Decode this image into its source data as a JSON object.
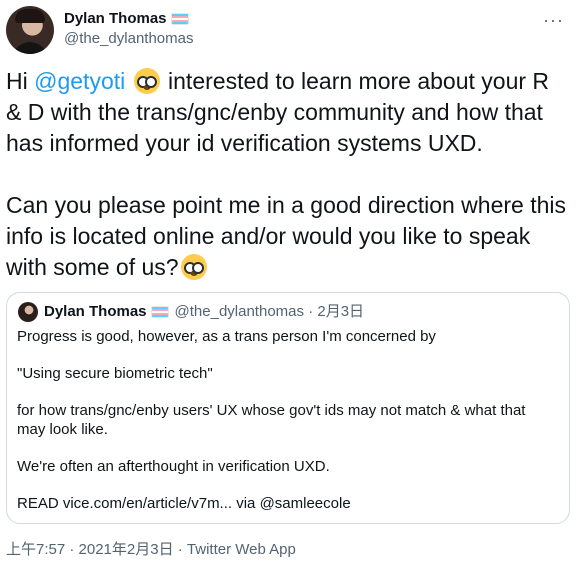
{
  "author": {
    "display_name": "Dylan Thomas",
    "handle": "@the_dylanthomas",
    "flag": "transgender-flag-icon"
  },
  "tweet": {
    "p1_a": "Hi ",
    "p1_mention": "@getyoti",
    "p1_b": " interested to learn more about your R & D with the trans/gnc/enby community and how that has informed your id verification systems UXD.",
    "p2": "Can you please point me in a good direction where this info is located online and/or would you like to speak with some of us?",
    "emoji": "nerd-face-icon"
  },
  "quoted": {
    "display_name": "Dylan Thomas",
    "handle": "@the_dylanthomas",
    "separator": "·",
    "date": "2月3日",
    "lines": [
      "Progress is good, however, as a trans person I'm concerned by",
      "\"Using secure biometric tech\"",
      "for how trans/gnc/enby users' UX whose gov't ids may not match & what that may look like.",
      "We're often an afterthought in verification UXD.",
      "READ vice.com/en/article/v7m... via @samleecole"
    ]
  },
  "meta": {
    "timestamp": "上午7:57 · 2021年2月3日 · Twitter Web App"
  },
  "colors": {
    "link": "#1d9bf0",
    "secondary_text": "#536471",
    "border": "#cfd9de"
  }
}
